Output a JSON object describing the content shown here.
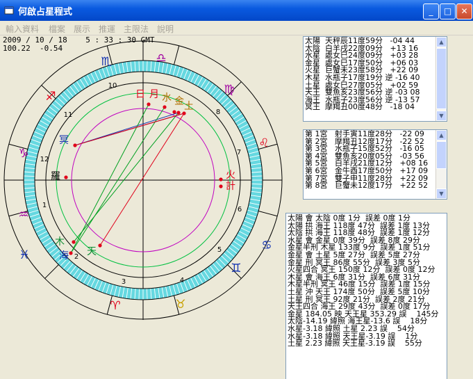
{
  "window": {
    "title": "何啟占星程式",
    "minimize": "_",
    "maximize": "□",
    "close": "✕"
  },
  "menu": [
    "輸入資料",
    "檔案",
    "展示",
    "推運",
    "主限法",
    "說明"
  ],
  "readout": {
    "line1": "2009 / 10 / 18    5 : 33 : 30 GMT",
    "line2": "100.22  -0.54"
  },
  "colors": {
    "title_blue": "#0a5ae0",
    "ring_cyan": "#66d8e0",
    "planet_red": "#e0001a",
    "zodiac_fire": "#e0001a",
    "zodiac_earth": "#c8a000",
    "zodiac_air": "#0a8a30",
    "zodiac_water": "#1030b0",
    "zodiac_purple": "#a000a0"
  },
  "chart": {
    "zodiac": [
      {
        "sign": "♏",
        "color": "#1030b0"
      },
      {
        "sign": "♎",
        "color": "#a000a0"
      },
      {
        "sign": "♍",
        "color": "#a000a0"
      },
      {
        "sign": "♌",
        "color": "#e0001a"
      },
      {
        "sign": "♋",
        "color": "#1030b0"
      },
      {
        "sign": "♊",
        "color": "#1030b0"
      },
      {
        "sign": "♉",
        "color": "#c8a000"
      },
      {
        "sign": "♈",
        "color": "#e0001a"
      },
      {
        "sign": "♓",
        "color": "#1030b0"
      },
      {
        "sign": "♒",
        "color": "#a000a0"
      },
      {
        "sign": "♑",
        "color": "#a000a0"
      },
      {
        "sign": "♐",
        "color": "#e0001a"
      }
    ],
    "houses": [
      "1",
      "2",
      "3",
      "4",
      "5",
      "6",
      "7",
      "8",
      "9",
      "10",
      "11",
      "12"
    ],
    "planets": [
      {
        "name": "日",
        "color": "#e0001a"
      },
      {
        "name": "月",
        "color": "#e0001a"
      },
      {
        "name": "水",
        "color": "#b07000"
      },
      {
        "name": "金",
        "color": "#b07000"
      },
      {
        "name": "土",
        "color": "#b07000"
      },
      {
        "name": "冥",
        "color": "#1030b0"
      },
      {
        "name": "羅",
        "color": "#000000"
      },
      {
        "name": "木",
        "color": "#0a8a30"
      },
      {
        "name": "海",
        "color": "#1030b0"
      },
      {
        "name": "天",
        "color": "#0a8a30"
      },
      {
        "name": "火",
        "color": "#e0001a"
      },
      {
        "name": "計",
        "color": "#e0001a"
      }
    ]
  },
  "planet_list": [
    "太陽  天秤辰11度59分   -04 44",
    "太陰  白羊戌22度09分   +13 16",
    "水星  處女巳24度09分   +03 28",
    "金星  處女巳17度50分   +06 03",
    "火星  巨蟹未23度58分   +22 09",
    "木星  水瓶子17度19分 逆 -16 40",
    "土星  處女巳27度05分   +02 59",
    "天王  雙魚亥23度56分 逆 -03 08",
    "海王  水瓶子23度56分 逆 -13 57",
    "冥王  摩羯丑00度48分   -18 04"
  ],
  "house_list": [
    "第 1宮   射手寅11度28分   -22 09",
    "第 2宮   摩羯丑12度17分   -22 52",
    "第 3宮   水瓶子15度52分   -16 05",
    "第 4宮   雙魚亥20度05分   -03 56",
    "第 5宮   白羊戌21度12分   +08 16",
    "第 6宮   金牛酉17度50分   +17 09",
    "第 7宮   雙子申11度28分   +22 09",
    "第 8宮   巨蟹未12度17分   +22 52"
  ],
  "aspect_list": [
    "太陽 會 太陰 0度 1分  誤差 0度 1分",
    "太陽 拱 海王 118度 47分  誤差 1度 13分",
    "太陰 拱 海王 118度 48分  誤差 1度 12分",
    "水星 會 金星 0度 39分  誤差 8度 29分",
    "金星半刑 木星 133度 9分  誤差 1度 51分",
    "金星 會 土星 5度 27分  誤差 5度 27分",
    "金星 刑 冥王 86度 55分  誤差 3度 5分",
    "火星四合 冥王 150度 12分  誤差 0度 12分",
    "木星 會 海王 6度 31分  誤差 6度 31分",
    "木星半刑 冥王 46度 15分  誤差 1度 15分",
    "土星 沖 天王 174度 50分  誤差 5度 10分",
    "土星 刑 冥王 92度 21分  誤差 2度 21分",
    "天王四合 海王 29度 43分  誤差 0度 17分",
    "金星 184.05 映 天王星 353.29 誤    145分",
    "太陰-14.19 緯照 海王星-13.6 誤    18分",
    "水星-3.18 緯照 土星 2.23 誤    54分",
    "水星-3.18 緯照 天王星-3.19 誤    1分",
    "土星 2.23 緯照 天王星-3.19 誤    55分"
  ]
}
